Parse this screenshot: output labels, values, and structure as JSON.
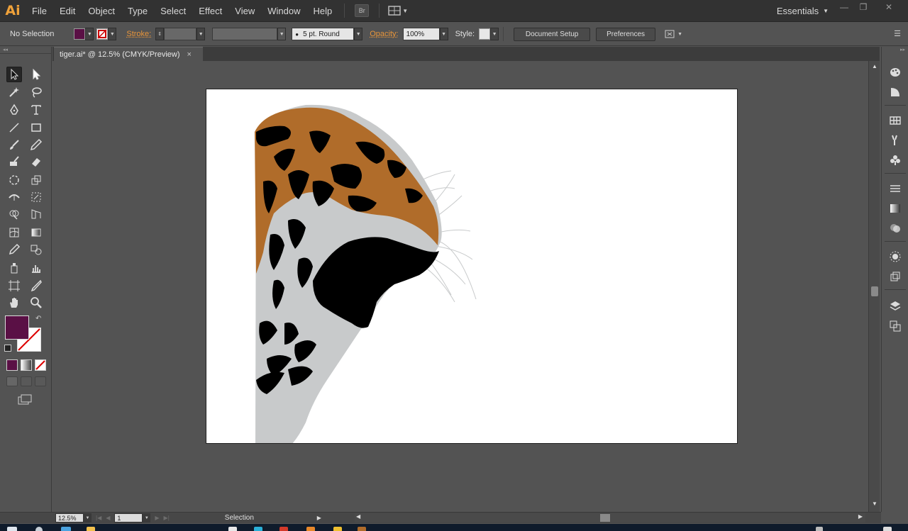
{
  "app": {
    "logo": "Ai",
    "workspace": "Essentials"
  },
  "menu": {
    "items": [
      "File",
      "Edit",
      "Object",
      "Type",
      "Select",
      "Effect",
      "View",
      "Window",
      "Help"
    ],
    "bridge_label": "Br"
  },
  "control_bar": {
    "selection_status": "No Selection",
    "stroke_label": "Stroke:",
    "brush_label": "5 pt. Round",
    "opacity_label": "Opacity:",
    "opacity_value": "100%",
    "style_label": "Style:",
    "document_setup_label": "Document Setup",
    "preferences_label": "Preferences"
  },
  "document": {
    "tab_title": "tiger.ai* @ 12.5% (CMYK/Preview)",
    "close_glyph": "×"
  },
  "status_bar": {
    "zoom": "12.5%",
    "artboard_number": "1",
    "current_tool": "Selection"
  },
  "colors": {
    "fill": "#5a1045",
    "tiger_orange": "#b06c2a",
    "tiger_grey": "#c8cacb",
    "tiger_black": "#000000",
    "accent_orange": "#f0a23a"
  },
  "tools": [
    "selection-tool",
    "direct-selection-tool",
    "magic-wand-tool",
    "lasso-tool",
    "pen-tool",
    "type-tool",
    "line-segment-tool",
    "rectangle-tool",
    "paintbrush-tool",
    "pencil-tool",
    "blob-brush-tool",
    "eraser-tool",
    "rotate-tool",
    "scale-tool",
    "width-tool",
    "free-transform-tool",
    "shape-builder-tool",
    "perspective-grid-tool",
    "mesh-tool",
    "gradient-tool",
    "eyedropper-tool",
    "blend-tool",
    "symbol-sprayer-tool",
    "column-graph-tool",
    "artboard-tool",
    "slice-tool",
    "hand-tool",
    "zoom-tool"
  ],
  "dock_panels": [
    "color-panel",
    "color-guide-panel",
    "swatches-panel",
    "brushes-panel",
    "symbols-panel",
    "stroke-panel",
    "gradient-panel",
    "transparency-panel",
    "appearance-panel",
    "graphic-styles-panel",
    "layers-panel",
    "artboards-panel"
  ]
}
